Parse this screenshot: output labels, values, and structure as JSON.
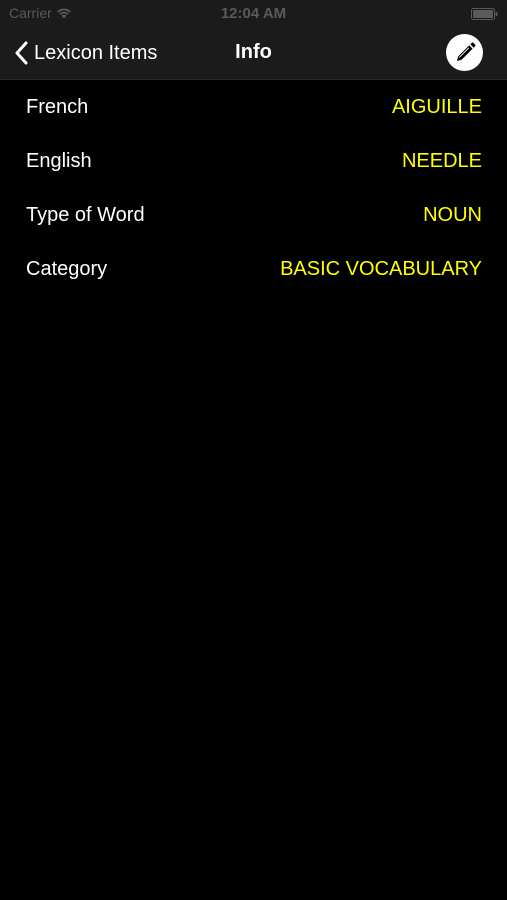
{
  "status_bar": {
    "carrier": "Carrier",
    "time": "12:04 AM"
  },
  "nav": {
    "back_label": "Lexicon Items",
    "title": "Info",
    "edit_icon": "pencil-icon"
  },
  "rows": [
    {
      "label": "French",
      "value": "AIGUILLE"
    },
    {
      "label": "English",
      "value": "NEEDLE"
    },
    {
      "label": "Type of Word",
      "value": "NOUN"
    },
    {
      "label": "Category",
      "value": "BASIC VOCABULARY"
    }
  ],
  "colors": {
    "background": "#000000",
    "bar": "#1b1b1b",
    "label": "#ffffff",
    "value": "#ffff00"
  }
}
